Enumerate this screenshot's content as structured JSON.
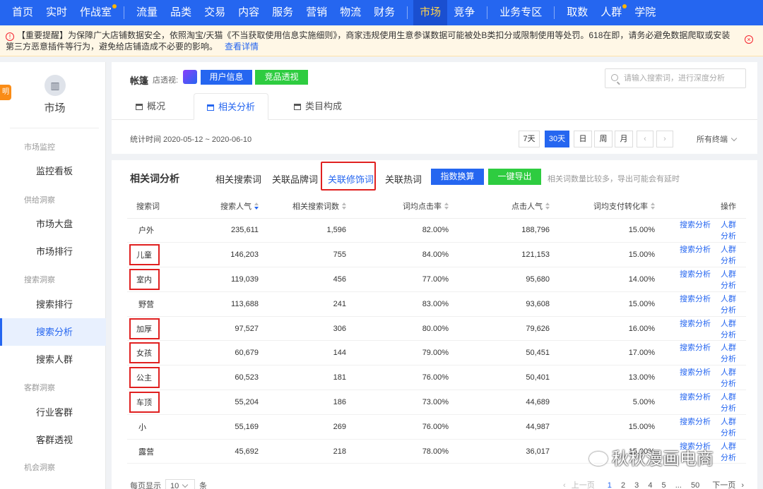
{
  "topnav": {
    "items": [
      "首页",
      "实时",
      "作战室",
      "流量",
      "品类",
      "交易",
      "内容",
      "服务",
      "营销",
      "物流",
      "财务",
      "市场",
      "竞争",
      "业务专区",
      "取数",
      "人群",
      "学院"
    ],
    "active": "市场"
  },
  "notice": {
    "text": "【重要提醒】为保障广大店铺数据安全，依照淘宝/天猫《不当获取使用信息实施细则》，商家违规使用生意参谋数据可能被处B类扣分或限制使用等处罚。618在即，请务必避免数据爬取或安装第三方恶意插件等行为，避免给店铺造成不必要的影响。",
    "link": "查看详情"
  },
  "sidebar": {
    "left_tab": "明",
    "title": "市场",
    "groups": {
      "g1": "市场监控",
      "g2": "供给洞察",
      "g3": "搜索洞察",
      "g4": "客群洞察",
      "g5": "机会洞察"
    },
    "items": {
      "i1": "监控看板",
      "i2": "市场大盘",
      "i3": "市场排行",
      "i4": "搜索排行",
      "i5": "搜索分析",
      "i6": "搜索人群",
      "i7": "行业客群",
      "i8": "客群透视"
    },
    "active": "搜索分析"
  },
  "header": {
    "shop_name": "帐篷",
    "shop_label": "店透视:",
    "user_info": "用户信息",
    "competitor": "竞品透视",
    "search_placeholder": "请输入搜索词，进行深度分析",
    "tabs": [
      "概况",
      "相关分析",
      "类目构成"
    ],
    "active_tab": "相关分析",
    "stat_time": "统计时间 2020-05-12 ~ 2020-06-10",
    "periods": [
      "7天",
      "30天",
      "日",
      "周",
      "月"
    ],
    "active_period": "30天",
    "terminal": "所有终端"
  },
  "panel": {
    "title": "相关词分析",
    "subtabs": [
      "相关搜索词",
      "关联品牌词",
      "关联修饰词",
      "关联热词"
    ],
    "active_subtab": "关联修饰词",
    "index_btn": "指数换算",
    "export_btn": "一键导出",
    "export_note": "相关词数量比较多，导出可能会有延时",
    "columns": [
      "搜索词",
      "搜索人气",
      "相关搜索词数",
      "词均点击率",
      "点击人气",
      "词均支付转化率",
      "操作"
    ],
    "action_search": "搜索分析",
    "action_crowd": "人群分析",
    "rows": [
      {
        "kw": "户外",
        "pop": "235,611",
        "rel": "1,596",
        "ctr": "82.00%",
        "click": "188,796",
        "cvr": "15.00%",
        "boxed": false
      },
      {
        "kw": "儿童",
        "pop": "146,203",
        "rel": "755",
        "ctr": "84.00%",
        "click": "121,153",
        "cvr": "15.00%",
        "boxed": true
      },
      {
        "kw": "室内",
        "pop": "119,039",
        "rel": "456",
        "ctr": "77.00%",
        "click": "95,680",
        "cvr": "14.00%",
        "boxed": true
      },
      {
        "kw": "野营",
        "pop": "113,688",
        "rel": "241",
        "ctr": "83.00%",
        "click": "93,608",
        "cvr": "15.00%",
        "boxed": false
      },
      {
        "kw": "加厚",
        "pop": "97,527",
        "rel": "306",
        "ctr": "80.00%",
        "click": "79,626",
        "cvr": "16.00%",
        "boxed": true
      },
      {
        "kw": "女孩",
        "pop": "60,679",
        "rel": "144",
        "ctr": "79.00%",
        "click": "50,451",
        "cvr": "17.00%",
        "boxed": true
      },
      {
        "kw": "公主",
        "pop": "60,523",
        "rel": "181",
        "ctr": "76.00%",
        "click": "50,401",
        "cvr": "13.00%",
        "boxed": true
      },
      {
        "kw": "车顶",
        "pop": "55,204",
        "rel": "186",
        "ctr": "73.00%",
        "click": "44,689",
        "cvr": "5.00%",
        "boxed": true
      },
      {
        "kw": "小",
        "pop": "55,169",
        "rel": "269",
        "ctr": "76.00%",
        "click": "44,987",
        "cvr": "15.00%",
        "boxed": false
      },
      {
        "kw": "露营",
        "pop": "45,692",
        "rel": "218",
        "ctr": "78.00%",
        "click": "36,017",
        "cvr": "15.00%",
        "boxed": false
      }
    ],
    "pager": {
      "per_page_label": "每页显示",
      "per_page": "10",
      "unit": "条",
      "prev": "上一页",
      "pages": [
        "1",
        "2",
        "3",
        "4",
        "5",
        "...",
        "50"
      ],
      "next": "下一页"
    }
  },
  "watermark": "秋秋漫画电商"
}
